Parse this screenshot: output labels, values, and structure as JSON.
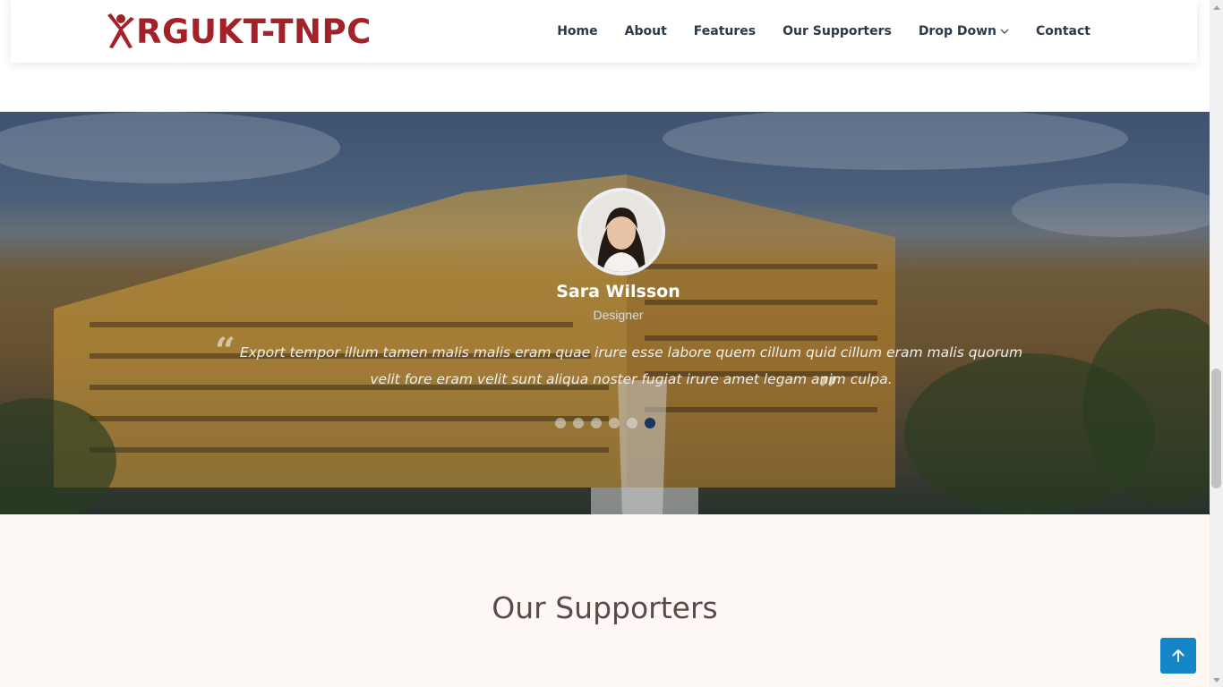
{
  "brand": {
    "name": "RGUKT-TNPC",
    "color": "#a3222a"
  },
  "nav": {
    "items": [
      {
        "label": "Home"
      },
      {
        "label": "About"
      },
      {
        "label": "Features"
      },
      {
        "label": "Our Supporters"
      },
      {
        "label": "Drop Down",
        "icon": "chevron-down-icon"
      },
      {
        "label": "Contact"
      }
    ]
  },
  "testimonial": {
    "name": "Sara Wilsson",
    "role": "Designer",
    "quote": "Export tempor illum tamen malis malis eram quae irure esse labore quem cillum quid cillum eram malis quorum velit fore eram velit sunt aliqua noster fugiat irure amet legam anim culpa.",
    "slide_count": 6,
    "active_slide": 6
  },
  "supporters": {
    "title": "Our Supporters"
  },
  "colors": {
    "accent": "#1486c8",
    "active_dot": "#16385e"
  }
}
